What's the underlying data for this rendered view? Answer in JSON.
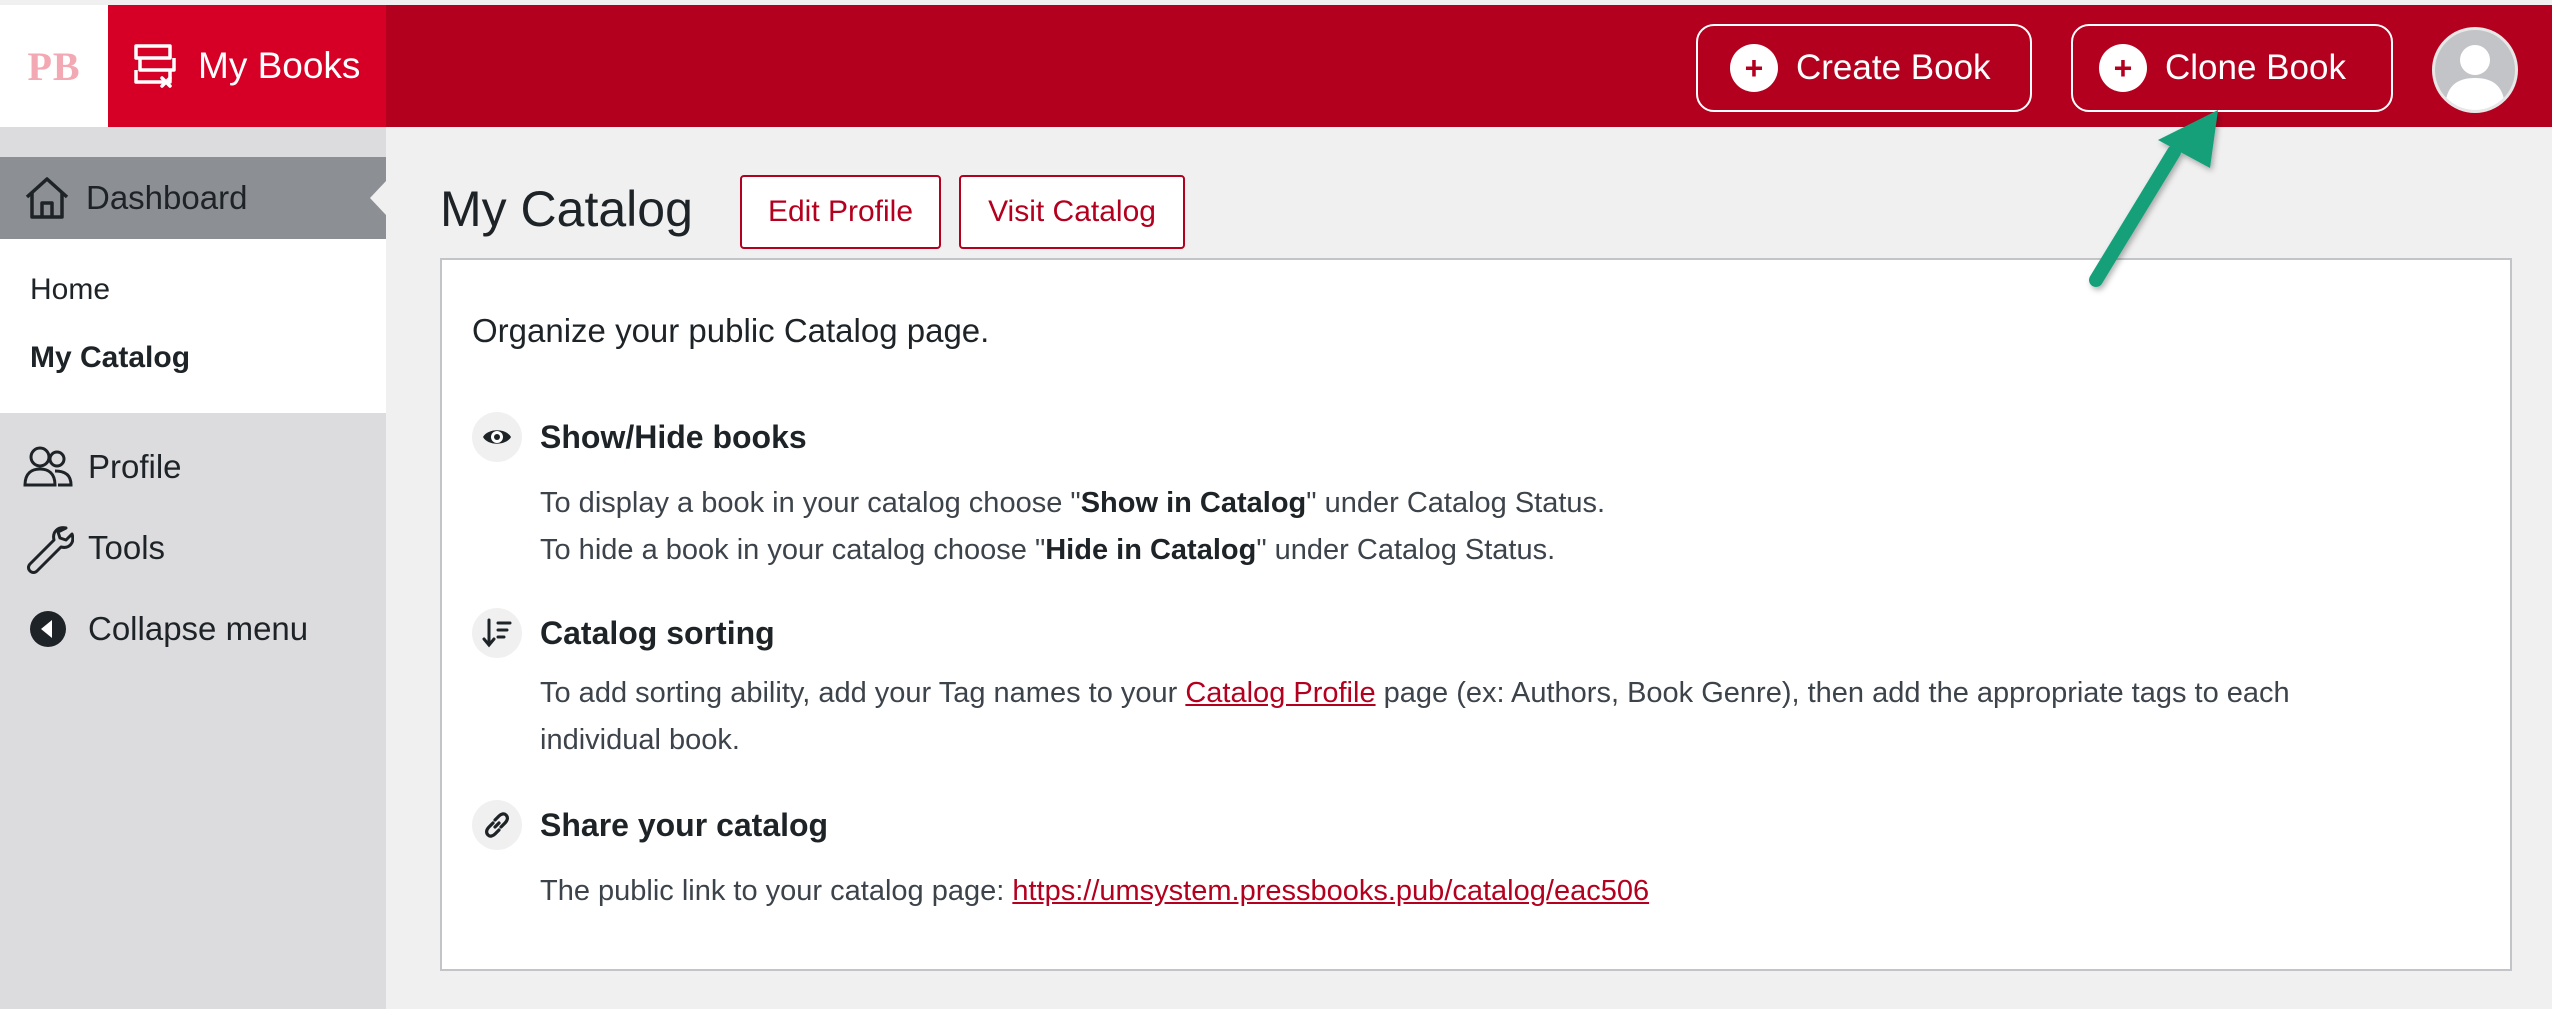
{
  "topbar": {
    "logo": "PB",
    "my_books": "My Books",
    "create_book": "Create Book",
    "clone_book": "Clone Book",
    "plus_glyph": "+"
  },
  "sidebar": {
    "dashboard": "Dashboard",
    "submenu": {
      "home": "Home",
      "my_catalog": "My Catalog"
    },
    "profile": "Profile",
    "tools": "Tools",
    "collapse": "Collapse menu"
  },
  "main": {
    "title": "My Catalog",
    "edit_profile": "Edit Profile",
    "visit_catalog": "Visit Catalog",
    "intro": "Organize your public Catalog page.",
    "show_hide": {
      "heading": "Show/Hide books",
      "line1_pre": "To display a book in your catalog choose \"",
      "line1_bold": "Show in Catalog",
      "line1_post": "\" under Catalog Status.",
      "line2_pre": "To hide a book in your catalog choose \"",
      "line2_bold": "Hide in Catalog",
      "line2_post": "\" under Catalog Status."
    },
    "sorting": {
      "heading": "Catalog sorting",
      "line1_pre": "To add sorting ability, add your Tag names to your ",
      "line1_link": "Catalog Profile",
      "line1_post": " page (ex: Authors, Book Genre), then add the appropriate tags to each",
      "line2": "individual book."
    },
    "share": {
      "heading": "Share your catalog",
      "pre": "The public link to your catalog page: ",
      "link": "https://umsystem.pressbooks.pub/catalog/eac506"
    }
  },
  "colors": {
    "brand": "#b4001f",
    "brand_light": "#d60027",
    "annotation_arrow": "#12a07a"
  },
  "icons": [
    "books-icon",
    "plus-circle-icon",
    "avatar-icon",
    "home-icon",
    "users-icon",
    "wrench-icon",
    "collapse-icon",
    "eye-icon",
    "sort-icon",
    "link-icon",
    "annotation-arrow-icon"
  ]
}
